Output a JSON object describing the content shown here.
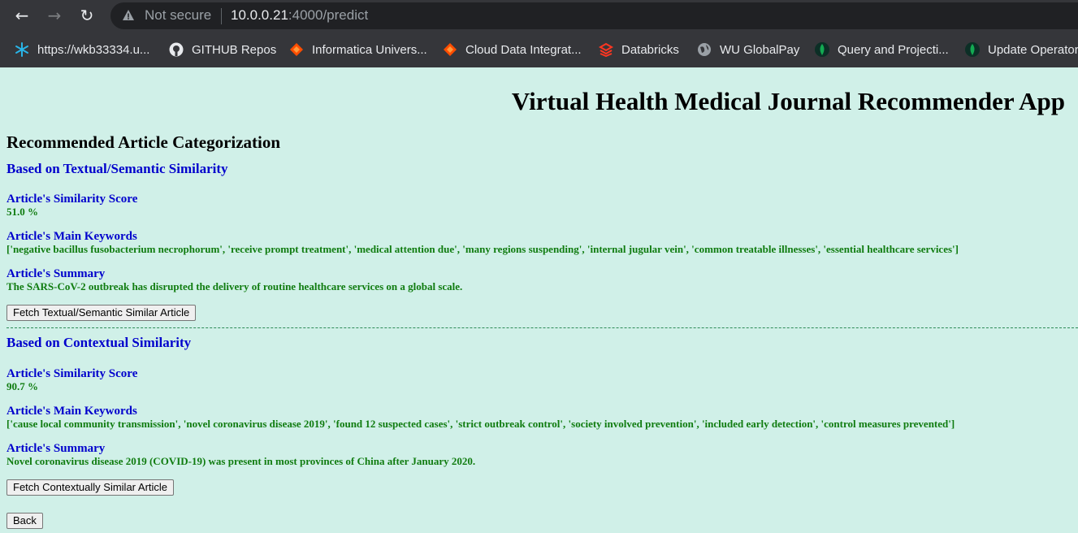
{
  "browser": {
    "security_label": "Not secure",
    "url_host": "10.0.0.21",
    "url_rest": ":4000/predict",
    "bookmarks": [
      {
        "label": "https://wkb33334.u...",
        "icon": "snowflake-icon"
      },
      {
        "label": "GITHUB Repos",
        "icon": "github-icon"
      },
      {
        "label": "Informatica Univers...",
        "icon": "informatica-icon"
      },
      {
        "label": "Cloud Data Integrat...",
        "icon": "informatica-icon"
      },
      {
        "label": "Databricks",
        "icon": "databricks-icon"
      },
      {
        "label": "WU GlobalPay",
        "icon": "globe-icon"
      },
      {
        "label": "Query and Projecti...",
        "icon": "mongodb-leaf-icon"
      },
      {
        "label": "Update Operators",
        "icon": "mongodb-leaf-icon"
      }
    ]
  },
  "page": {
    "app_title": "Virtual Health Medical Journal Recommender App",
    "section_title": "Recommended Article Categorization",
    "textual": {
      "heading": "Based on Textual/Semantic Similarity",
      "score_label": "Article's Similarity Score",
      "score_value": "51.0 %",
      "keywords_label": "Article's Main Keywords",
      "keywords_value": "['negative bacillus fusobacterium necrophorum', 'receive prompt treatment', 'medical attention due', 'many regions suspending', 'internal jugular vein', 'common treatable illnesses', 'essential healthcare services']",
      "summary_label": "Article's Summary",
      "summary_value": "The SARS-CoV-2 outbreak has disrupted the delivery of routine healthcare services on a global scale.",
      "button_label": "Fetch Textual/Semantic Similar Article"
    },
    "contextual": {
      "heading": "Based on Contextual Similarity",
      "score_label": "Article's Similarity Score",
      "score_value": "90.7 %",
      "keywords_label": "Article's Main Keywords",
      "keywords_value": "['cause local community transmission', 'novel coronavirus disease 2019', 'found 12 suspected cases', 'strict outbreak control', 'society involved prevention', 'included early detection', 'control measures prevented']",
      "summary_label": "Article's Summary",
      "summary_value": "Novel coronavirus disease 2019 (COVID-19) was present in most provinces of China after January 2020.",
      "button_label": "Fetch Contextually Similar Article"
    },
    "back_button_label": "Back"
  },
  "colors": {
    "page_background": "#d0f0e8",
    "heading_blue": "#0000cc",
    "value_green": "#107c10"
  }
}
